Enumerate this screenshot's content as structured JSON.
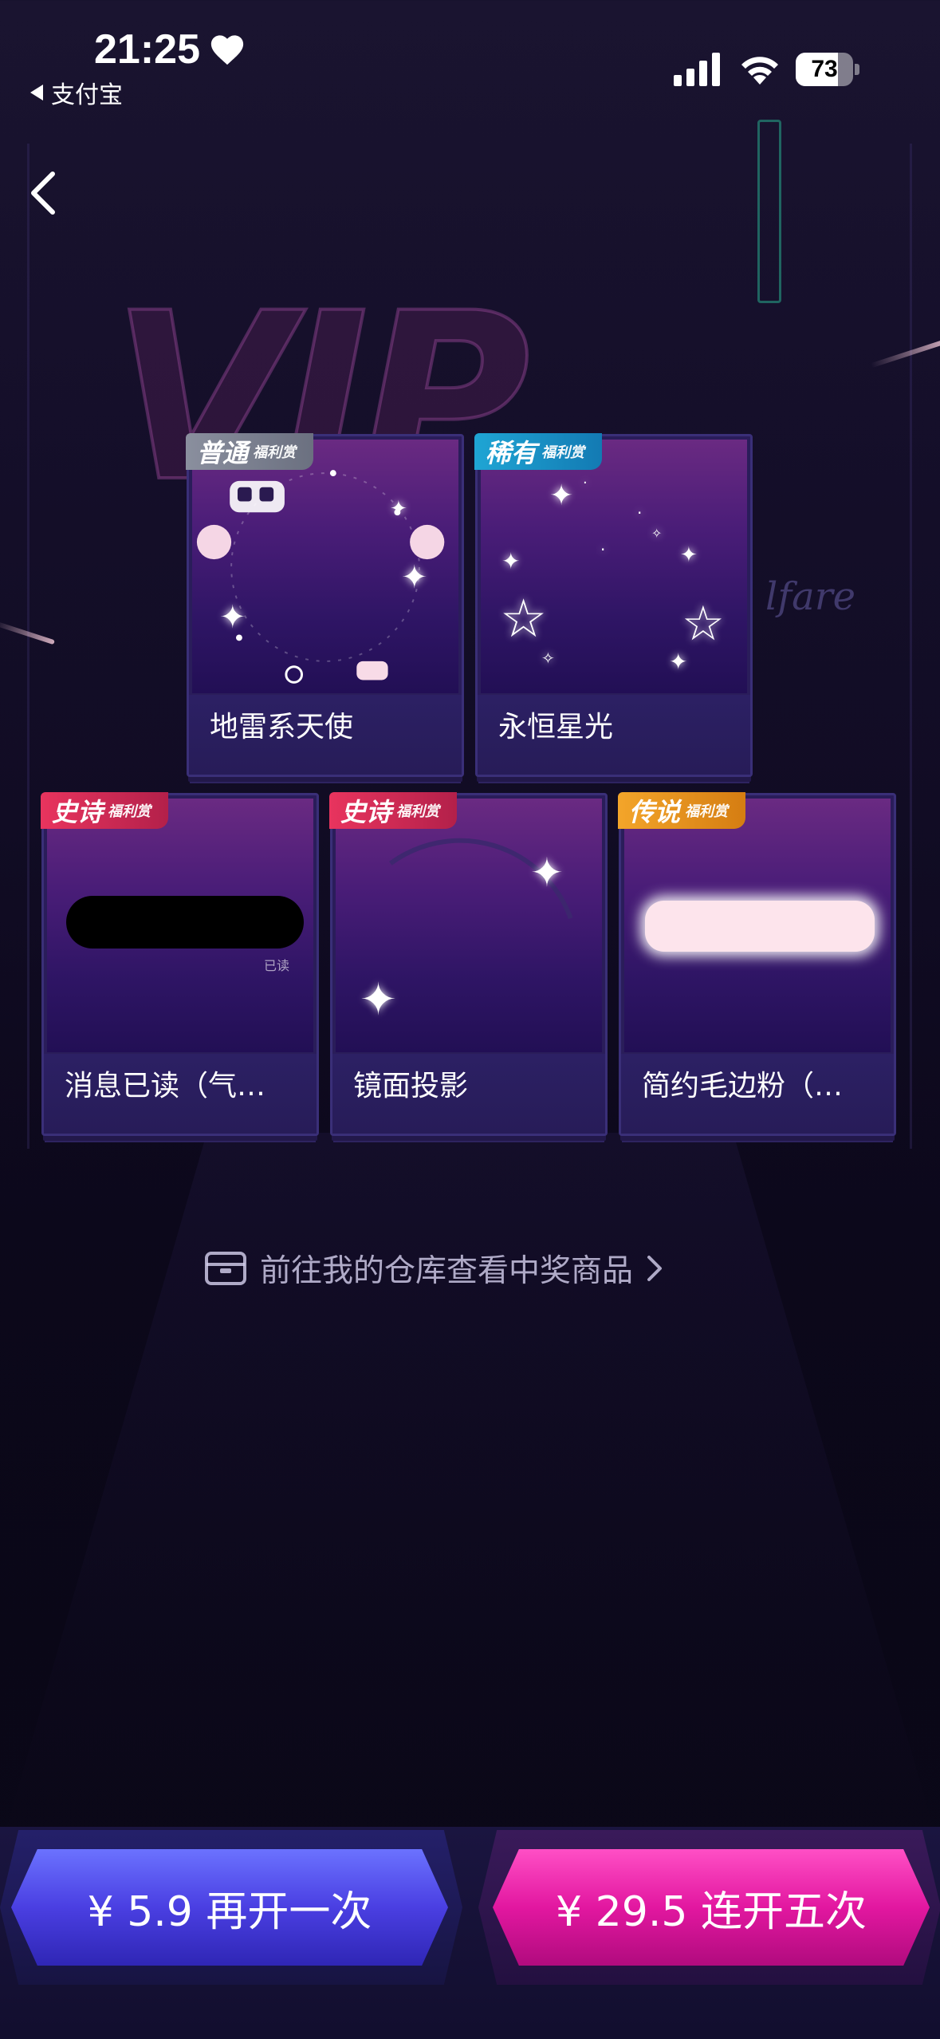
{
  "status_bar": {
    "time": "21:25",
    "back_app": "支付宝",
    "battery_level": "73",
    "battery_fraction": 0.73
  },
  "cards": [
    {
      "tag": "普通",
      "tag_small": "福利赏",
      "label": "地雷系天使",
      "rarity": "common"
    },
    {
      "tag": "稀有",
      "tag_small": "福利赏",
      "label": "永恒星光",
      "rarity": "rare"
    },
    {
      "tag": "史诗",
      "tag_small": "福利赏",
      "label": "消息已读（气…",
      "rarity": "epic",
      "overlay_text": "已读"
    },
    {
      "tag": "史诗",
      "tag_small": "福利赏",
      "label": "镜面投影",
      "rarity": "epic"
    },
    {
      "tag": "传说",
      "tag_small": "福利赏",
      "label": "简约毛边粉（…",
      "rarity": "legend"
    }
  ],
  "warehouse_link": "前往我的仓库查看中奖商品",
  "buttons": {
    "again": "¥ 5.9 再开一次",
    "five": "¥ 29.5 连开五次"
  },
  "colors": {
    "btn_blue": "#4a3fe2",
    "btn_pink": "#e217a0",
    "tag_common": "#7c8190",
    "tag_rare": "#1a90c6",
    "tag_epic": "#d52a55",
    "tag_legend": "#e8921f"
  }
}
